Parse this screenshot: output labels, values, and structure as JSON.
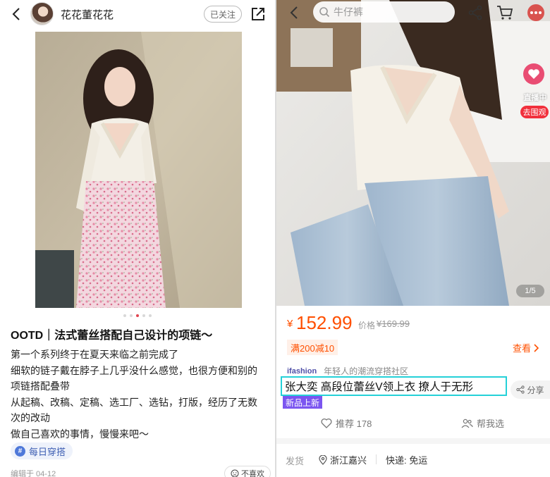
{
  "left": {
    "author_name": "花花董花花",
    "follow_label": "已关注",
    "carousel": {
      "total": 5,
      "active_index": 3
    },
    "post_title": "OOTD｜法式蕾丝搭配自己设计的项链～",
    "post_body_lines": [
      "第一个系列终于在夏天来临之前完成了",
      "细软的链子戴在脖子上几乎没什么感觉，也很方便和别的",
      "项链搭配叠带",
      "从起稿、改稿、定稿、选工厂、选钻，打版，经历了无数",
      "次的改动",
      "做自己喜欢的事情，慢慢来吧～"
    ],
    "tag_label": "每日穿搭",
    "edited_text": "编辑于 04-12",
    "dislike_label": "不喜欢"
  },
  "right": {
    "search_placeholder": "牛仔裤",
    "live": {
      "label": "直播中",
      "go_label": "去围观"
    },
    "image_counter": "1/5",
    "price_symbol": "¥",
    "price": "152.99",
    "orig_label": "价格",
    "orig_price": "¥169.99",
    "coupon": "满200减10",
    "see_more": "查看",
    "brand_logo": "ifashion",
    "brand_slogan": "年轻人的潮流穿搭社区",
    "product_title": "张大奕  高段位蕾丝V领上衣  撩人于无形",
    "share_label": "分享",
    "new_tag": "新品上新",
    "recommend_label": "推荐 178",
    "help_label": "帮我选",
    "ship_label": "发货",
    "ship_location": "浙江嘉兴",
    "ship_fee": "快递: 免运"
  },
  "icons": [
    "back-icon",
    "share-out-icon",
    "search-icon",
    "share-icon",
    "cart-icon",
    "more-icon",
    "heart-icon",
    "location-icon",
    "thumb-icon",
    "people-icon",
    "chevron-right-icon",
    "hash-icon",
    "sad-face-icon"
  ],
  "colors": {
    "price": "#ff4f00",
    "highlight_box": "#25d1d8",
    "new_tag": "#7b55f0",
    "live": "#f1303c",
    "active_dot": "#e0454f"
  }
}
